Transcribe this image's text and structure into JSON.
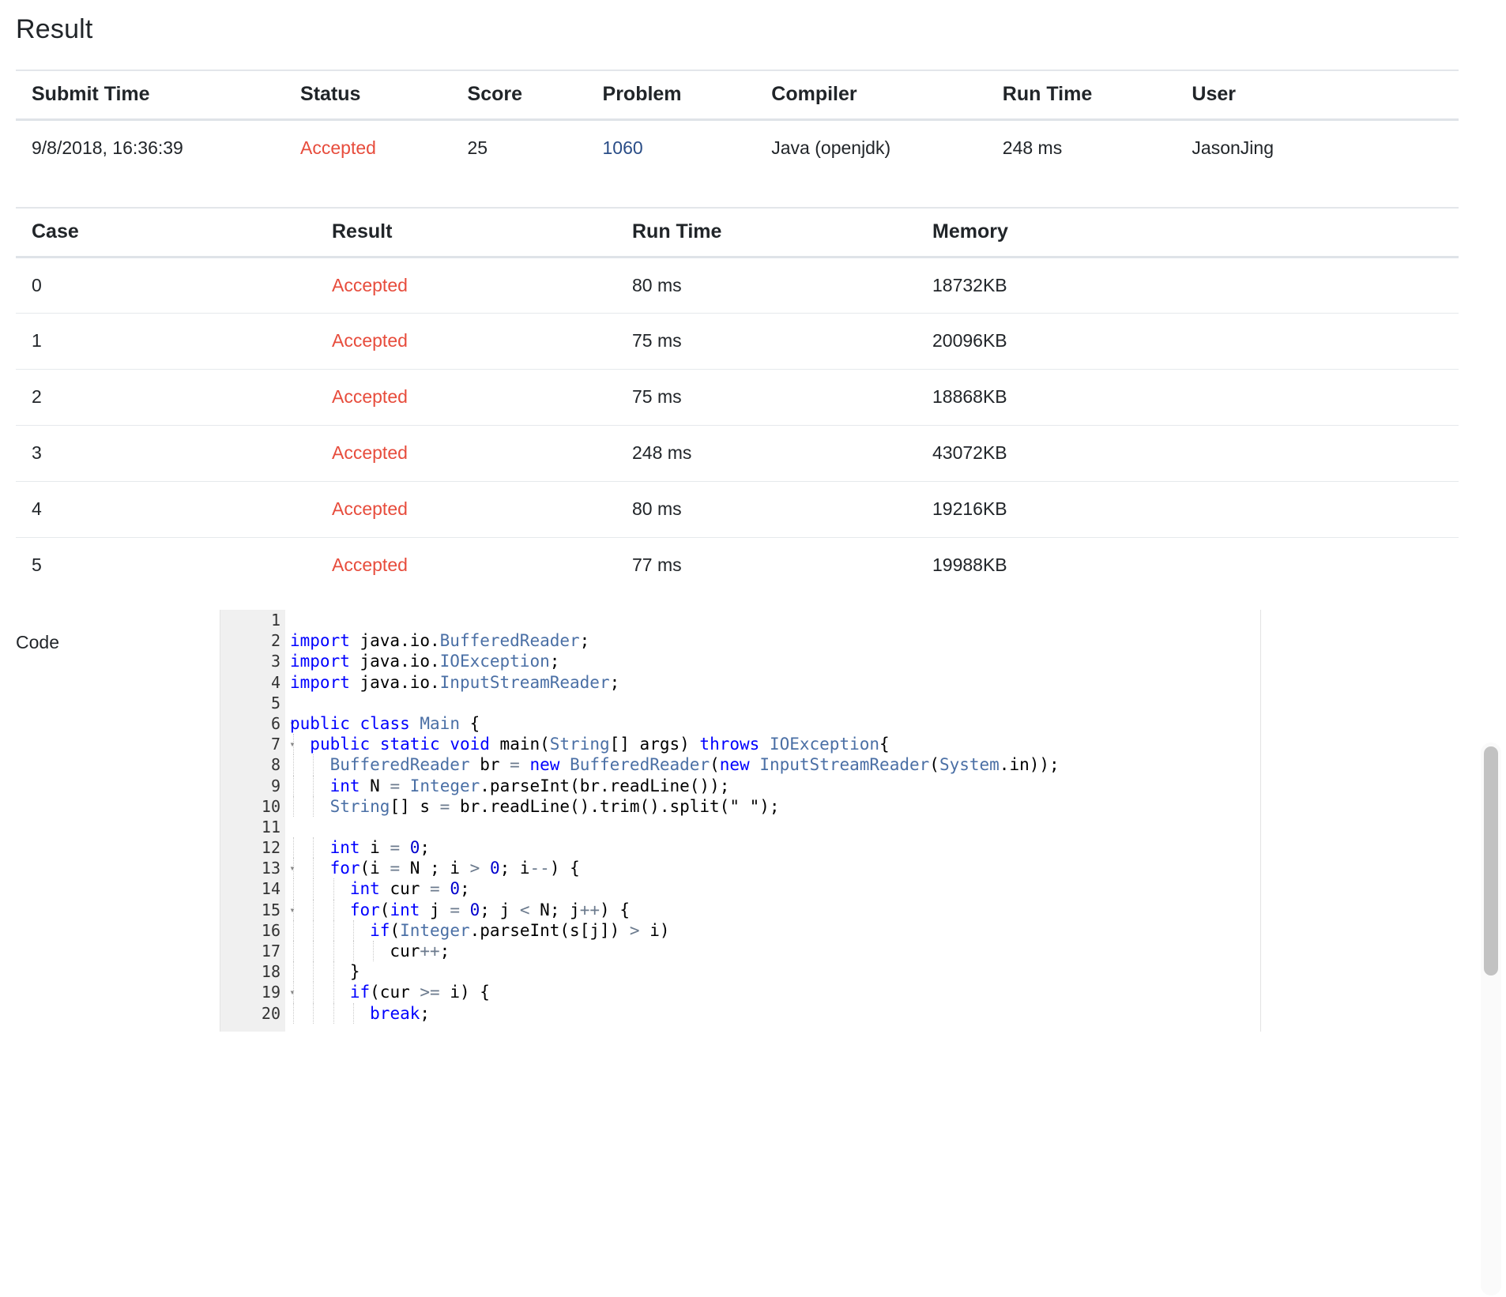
{
  "page": {
    "title": "Result"
  },
  "submission_table": {
    "headers": [
      "Submit Time",
      "Status",
      "Score",
      "Problem",
      "Compiler",
      "Run Time",
      "User"
    ],
    "row": {
      "submit_time": "9/8/2018, 16:36:39",
      "status": "Accepted",
      "score": "25",
      "problem": "1060",
      "compiler": "Java (openjdk)",
      "run_time": "248 ms",
      "user": "JasonJing"
    }
  },
  "case_table": {
    "headers": [
      "Case",
      "Result",
      "Run Time",
      "Memory"
    ],
    "rows": [
      {
        "case": "0",
        "result": "Accepted",
        "run_time": "80 ms",
        "memory": "18732KB"
      },
      {
        "case": "1",
        "result": "Accepted",
        "run_time": "75 ms",
        "memory": "20096KB"
      },
      {
        "case": "2",
        "result": "Accepted",
        "run_time": "75 ms",
        "memory": "18868KB"
      },
      {
        "case": "3",
        "result": "Accepted",
        "run_time": "248 ms",
        "memory": "43072KB"
      },
      {
        "case": "4",
        "result": "Accepted",
        "run_time": "80 ms",
        "memory": "19216KB"
      },
      {
        "case": "5",
        "result": "Accepted",
        "run_time": "77 ms",
        "memory": "19988KB"
      }
    ]
  },
  "code_section": {
    "label": "Code",
    "language": "java",
    "line_numbers": [
      "1",
      "2",
      "3",
      "4",
      "5",
      "6",
      "7",
      "8",
      "9",
      "10",
      "11",
      "12",
      "13",
      "14",
      "15",
      "16",
      "17",
      "18",
      "19",
      "20"
    ],
    "fold_lines": [
      "6",
      "7",
      "13",
      "15",
      "19"
    ],
    "lines": [
      "",
      "import java.io.BufferedReader;",
      "import java.io.IOException;",
      "import java.io.InputStreamReader;",
      "",
      "public class Main {",
      "  public static void main(String[] args) throws IOException{",
      "    BufferedReader br = new BufferedReader(new InputStreamReader(System.in));",
      "    int N = Integer.parseInt(br.readLine());",
      "    String[] s = br.readLine().trim().split(\" \");",
      "",
      "    int i = 0;",
      "    for(i = N ; i > 0; i--) {",
      "      int cur = 0;",
      "      for(int j = 0; j < N; j++) {",
      "        if(Integer.parseInt(s[j]) > i)",
      "          cur++;",
      "      }",
      "      if(cur >= i) {",
      "        break;"
    ]
  },
  "colors": {
    "accepted": "#e74c3c",
    "link": "#2a4d87",
    "keyword": "#0000ff",
    "type": "#4a6fa5",
    "text": "#212529",
    "gutter_bg": "#f0f0f0",
    "row_border": "#e6e9ec"
  },
  "scrollbar": {
    "name": "page-vertical-scrollbar"
  }
}
